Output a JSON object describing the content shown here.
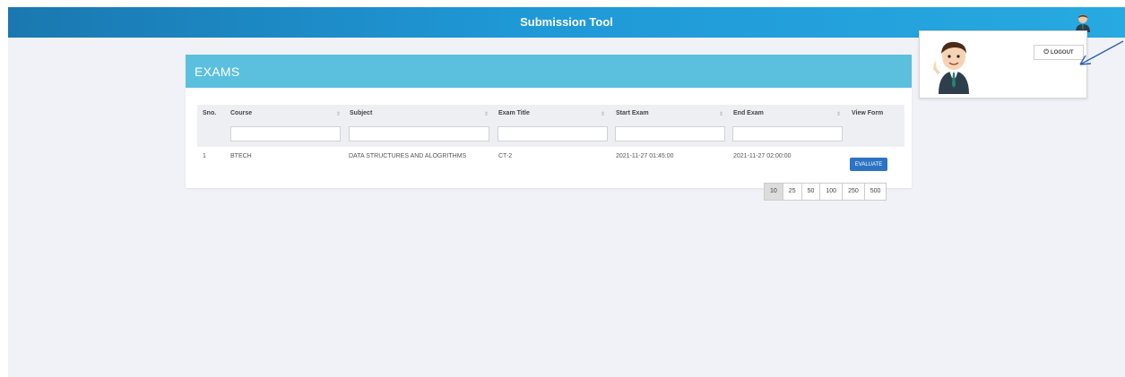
{
  "header": {
    "title": "Submission Tool",
    "avatar_icon": "user-avatar-icon"
  },
  "exams": {
    "title": "EXAMS",
    "columns": [
      "Sno.",
      "Course",
      "Subject",
      "Exam Title",
      "Start Exam",
      "End Exam",
      "View Form"
    ],
    "filters": {
      "course": "",
      "subject": "",
      "exam_title": "",
      "start_exam": "",
      "end_exam": ""
    },
    "rows": [
      {
        "sno": "1",
        "course": "BTECH",
        "subject": "DATA STRUCTURES AND ALOGRITHMS",
        "exam_title": "CT-2",
        "start": "2021-11-27 01:45:00",
        "end": "2021-11-27 02:00:00",
        "action": "EVALUATE"
      }
    ],
    "page_sizes": [
      "10",
      "25",
      "50",
      "100",
      "250",
      "500"
    ],
    "active_page_size": "10"
  },
  "user_menu": {
    "logout_label": "LOGOUT"
  },
  "colors": {
    "header_start": "#1a78b0",
    "header_end": "#27a9e1",
    "panel_header": "#5bc0de",
    "button": "#2d73c3"
  }
}
